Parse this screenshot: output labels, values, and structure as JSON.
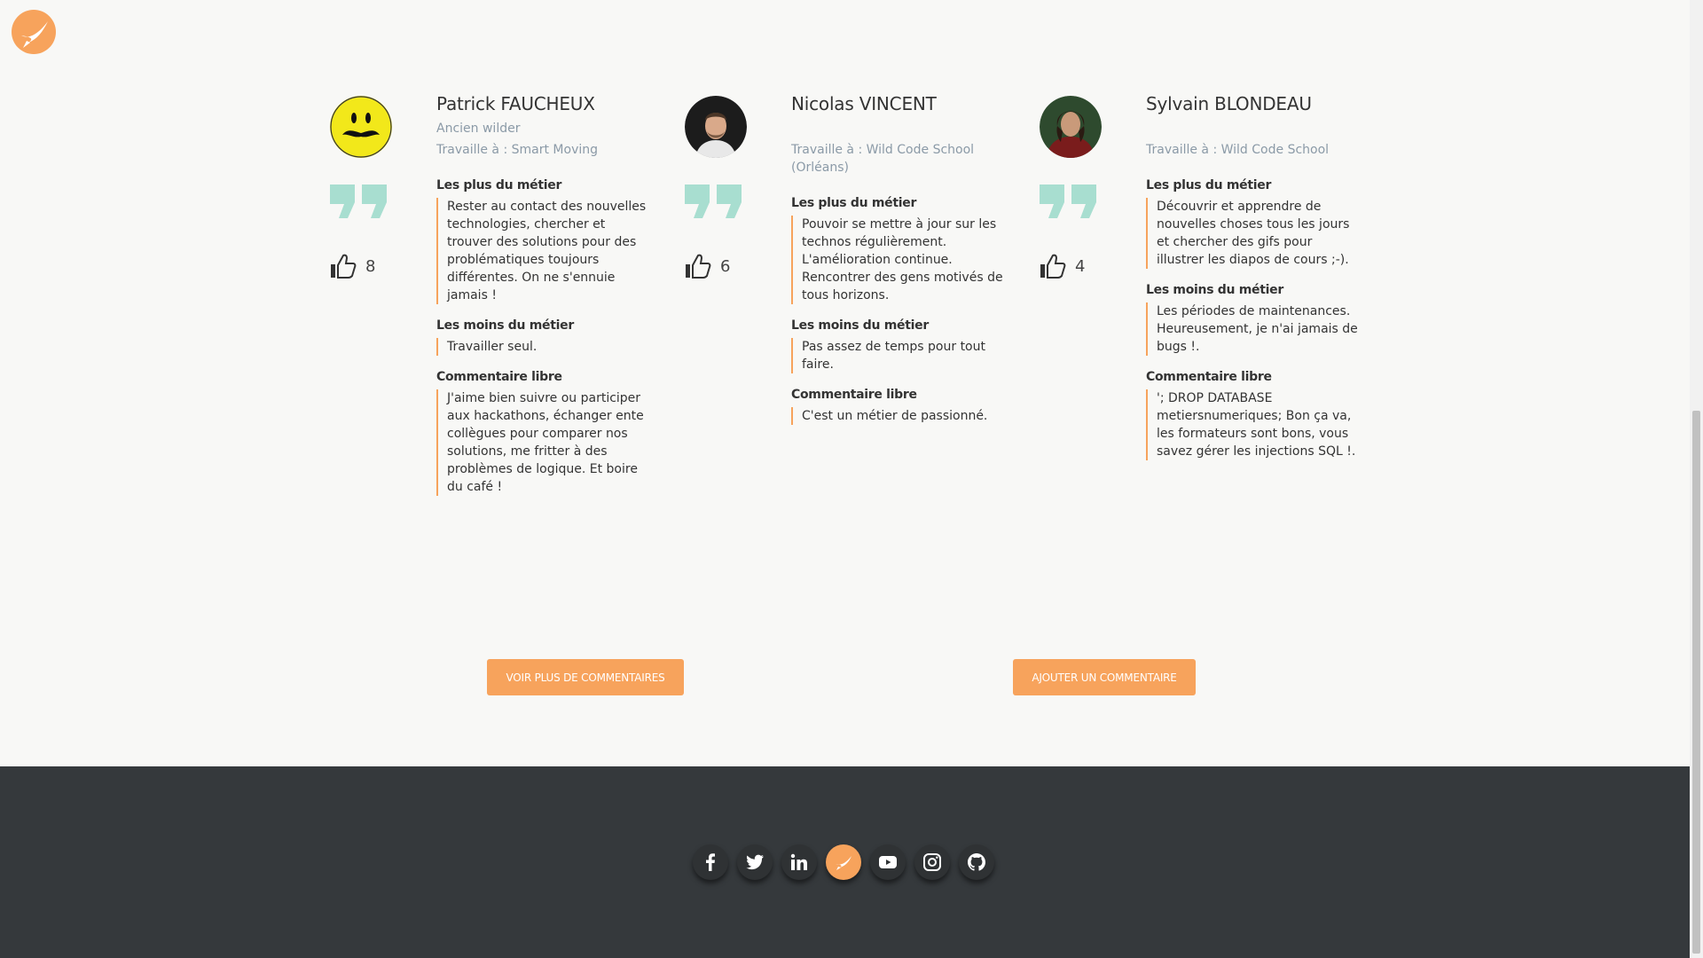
{
  "testimonials": [
    {
      "name": "Patrick FAUCHEUX",
      "role": "Ancien wilder",
      "work": "Travaille à : Smart Moving",
      "likes": "8",
      "plus_title": "Les plus du métier",
      "plus": "Rester au contact des nouvelles technologies, chercher et trouver des solutions pour des problématiques toujours différentes. On ne s'ennuie jamais !",
      "moins_title": "Les moins du métier",
      "moins": "Travailler seul.",
      "libre_title": "Commentaire libre",
      "libre": "J'aime bien suivre ou participer aux hackathons, échanger ente collègues pour comparer nos solutions, me fritter à des problèmes de logique. Et boire du café !"
    },
    {
      "name": "Nicolas VINCENT",
      "role": "",
      "work": "Travaille à : Wild Code School (Orléans)",
      "likes": "6",
      "plus_title": "Les plus du métier",
      "plus": "Pouvoir se mettre à jour sur les technos régulièrement. L'amélioration continue. Rencontrer des gens motivés de tous horizons.",
      "moins_title": "Les moins du métier",
      "moins": "Pas assez de temps pour tout faire.",
      "libre_title": "Commentaire libre",
      "libre": "C'est un métier de passionné."
    },
    {
      "name": "Sylvain BLONDEAU",
      "role": "",
      "work": "Travaille à : Wild Code School",
      "likes": "4",
      "plus_title": "Les plus du métier",
      "plus": "Découvrir et apprendre de nouvelles choses tous les jours et chercher des gifs pour illustrer les diapos de cours ;-).",
      "moins_title": "Les moins du métier",
      "moins": "Les périodes de maintenances. Heureusement, je n'ai jamais de bugs !.",
      "libre_title": "Commentaire libre",
      "libre": "'; DROP DATABASE metiersnumeriques; Bon ça va, les formateurs sont bons, vous savez gérer les injections SQL !."
    }
  ],
  "buttons": {
    "more": "Voir plus de commentaires",
    "add": "Ajouter un commentaire"
  },
  "footer": {
    "socials": [
      "facebook-icon",
      "twitter-icon",
      "linkedin-icon",
      "wild-code-school-icon",
      "youtube-icon",
      "instagram-icon",
      "github-icon"
    ]
  },
  "colors": {
    "accent": "#f7a35c",
    "footer_bg": "#35393c",
    "muted_text": "#8b9aa7",
    "quote_mark": "#a8ded0"
  }
}
